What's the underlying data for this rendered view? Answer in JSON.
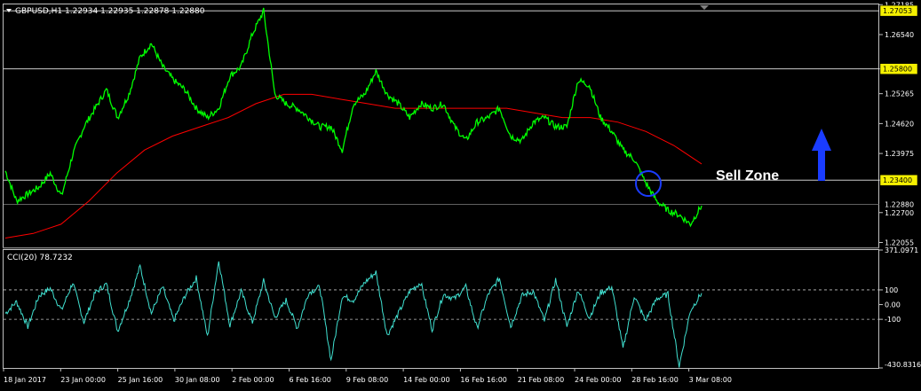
{
  "symbol_header": "GBPUSD,H1  1.22934 1.22935 1.22878 1.22880",
  "indicator_header": "CCI(20) 78.7232",
  "annotation": "Sell Zone",
  "colors": {
    "price": "#00ff00",
    "ma": "#ff0000",
    "cci": "#40e0d0",
    "level_line": "#f5f000",
    "arrow": "#1a3cff",
    "circle": "#1a3cff"
  },
  "chart_data": [
    {
      "type": "line",
      "title": "GBPUSD,H1",
      "price_axis_ticks": [
        "1.27185",
        "1.26540",
        "1.25800",
        "1.25265",
        "1.24620",
        "1.23975",
        "1.23400",
        "1.22700",
        "1.22055"
      ],
      "price_axis_labels": [
        {
          "text": "1.27053",
          "highlight": true
        },
        {
          "text": "1.25800",
          "highlight": true
        },
        {
          "text": "1.23400",
          "highlight": true
        },
        {
          "text": "1.22880",
          "highlight": false
        }
      ],
      "horizontal_levels": [
        1.27053,
        1.258,
        1.234
      ],
      "current_price": 1.2288,
      "ylim": [
        1.2195,
        1.2719
      ],
      "x_ticks": [
        "18 Jan 2017",
        "23 Jan 00:00",
        "25 Jan 16:00",
        "30 Jan 08:00",
        "2 Feb 00:00",
        "6 Feb 16:00",
        "9 Feb 08:00",
        "14 Feb 00:00",
        "16 Feb 16:00",
        "21 Feb 08:00",
        "24 Feb 00:00",
        "28 Feb 16:00",
        "3 Mar 08:00"
      ],
      "series": [
        {
          "name": "GBPUSD",
          "values": [
            1.236,
            1.2295,
            1.231,
            1.2325,
            1.2355,
            1.2305,
            1.2395,
            1.2455,
            1.2495,
            1.2535,
            1.2475,
            1.2525,
            1.2605,
            1.2635,
            1.2585,
            1.2555,
            1.2535,
            1.2495,
            1.2475,
            1.2495,
            1.2565,
            1.2585,
            1.2655,
            1.2705,
            1.2525,
            1.2505,
            1.2495,
            1.2475,
            1.2455,
            1.2455,
            1.2405,
            1.2505,
            1.2525,
            1.2575,
            1.2525,
            1.2505,
            1.2475,
            1.2505,
            1.2495,
            1.2505,
            1.2455,
            1.2425,
            1.2465,
            1.2475,
            1.2495,
            1.2435,
            1.2425,
            1.2465,
            1.2475,
            1.2455,
            1.2455,
            1.2555,
            1.2545,
            1.2475,
            1.2445,
            1.2405,
            1.2385,
            1.2335,
            1.2295,
            1.2275,
            1.2265,
            1.2245,
            1.2285
          ]
        },
        {
          "name": "Moving Average",
          "values": [
            1.2215,
            1.2225,
            1.2245,
            1.2295,
            1.2355,
            1.2405,
            1.2435,
            1.2455,
            1.2475,
            1.2505,
            1.2525,
            1.2525,
            1.2515,
            1.2505,
            1.2495,
            1.2495,
            1.2495,
            1.2495,
            1.2495,
            1.2485,
            1.2475,
            1.2475,
            1.2465,
            1.2445,
            1.2415,
            1.2375
          ]
        }
      ]
    },
    {
      "type": "line",
      "title": "CCI(20) 78.7232",
      "y_ticks": [
        "371.0971",
        "100",
        "0.00",
        "-100",
        "-430.8316"
      ],
      "levels": [
        100,
        -100
      ],
      "ylim": [
        -430.8316,
        371.0971
      ],
      "series": [
        {
          "name": "CCI(20)",
          "values": [
            -60,
            20,
            -150,
            60,
            110,
            -40,
            150,
            -120,
            80,
            140,
            -180,
            20,
            260,
            -60,
            120,
            -110,
            60,
            180,
            -220,
            300,
            -140,
            90,
            -120,
            160,
            -90,
            30,
            -160,
            80,
            120,
            -380,
            60,
            30,
            150,
            220,
            -210,
            -60,
            90,
            150,
            -170,
            70,
            40,
            120,
            -160,
            70,
            180,
            -150,
            60,
            90,
            -110,
            170,
            -150,
            100,
            -90,
            80,
            120,
            -300,
            60,
            -110,
            40,
            70,
            -420,
            -40,
            79
          ]
        }
      ]
    }
  ]
}
